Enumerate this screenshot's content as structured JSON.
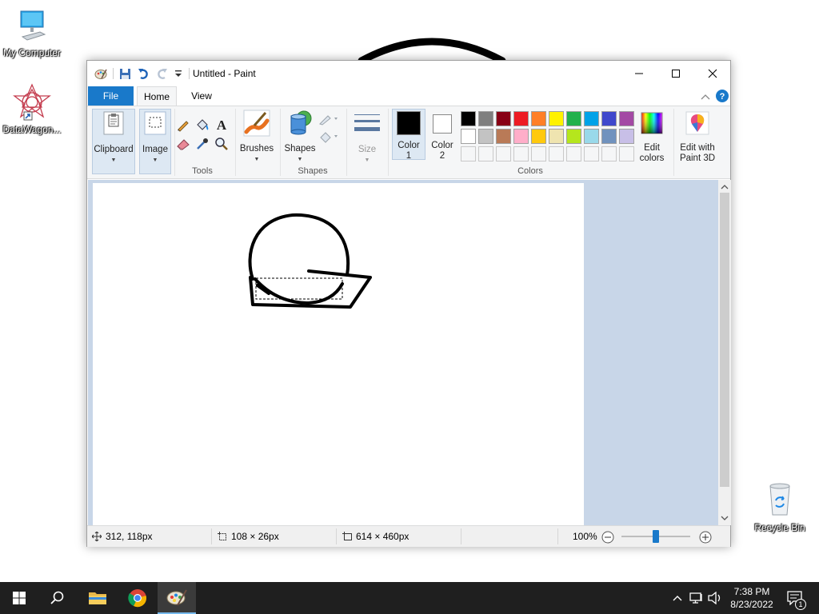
{
  "desktop": {
    "icons": [
      {
        "label": "My Computer"
      },
      {
        "label": "DataWagon..."
      },
      {
        "label": "Recycle Bin"
      }
    ]
  },
  "window": {
    "title": "Untitled - Paint",
    "tabs": {
      "file": "File",
      "home": "Home",
      "view": "View"
    }
  },
  "ribbon": {
    "clipboard": "Clipboard",
    "image": "Image",
    "tools_group": "Tools",
    "brushes": "Brushes",
    "shapes": "Shapes",
    "shapes_group": "Shapes",
    "size": "Size",
    "color1_line1": "Color",
    "color1_line2": "1",
    "color2_line1": "Color",
    "color2_line2": "2",
    "edit_colors_line1": "Edit",
    "edit_colors_line2": "colors",
    "paint3d_line1": "Edit with",
    "paint3d_line2": "Paint 3D",
    "colors_group": "Colors",
    "palette_row1": [
      "#000000",
      "#7f7f7f",
      "#880015",
      "#ed1c24",
      "#ff7f27",
      "#fff200",
      "#22b14c",
      "#00a2e8",
      "#3f48cc",
      "#a349a4"
    ],
    "palette_row2": [
      "#ffffff",
      "#c3c3c3",
      "#b97a57",
      "#ffaec9",
      "#ffc90e",
      "#efe4b0",
      "#b5e61d",
      "#99d9ea",
      "#7092be",
      "#c8bfe7"
    ],
    "color1": "#000000",
    "color2": "#ffffff"
  },
  "status": {
    "cursor_pos": "312, 118px",
    "selection_size": "108 × 26px",
    "image_size": "614 × 460px",
    "zoom": "100%",
    "zoom_slider_level": 0.5
  },
  "taskbar": {
    "time": "7:38 PM",
    "date": "8/23/2022",
    "notifications": "1"
  }
}
